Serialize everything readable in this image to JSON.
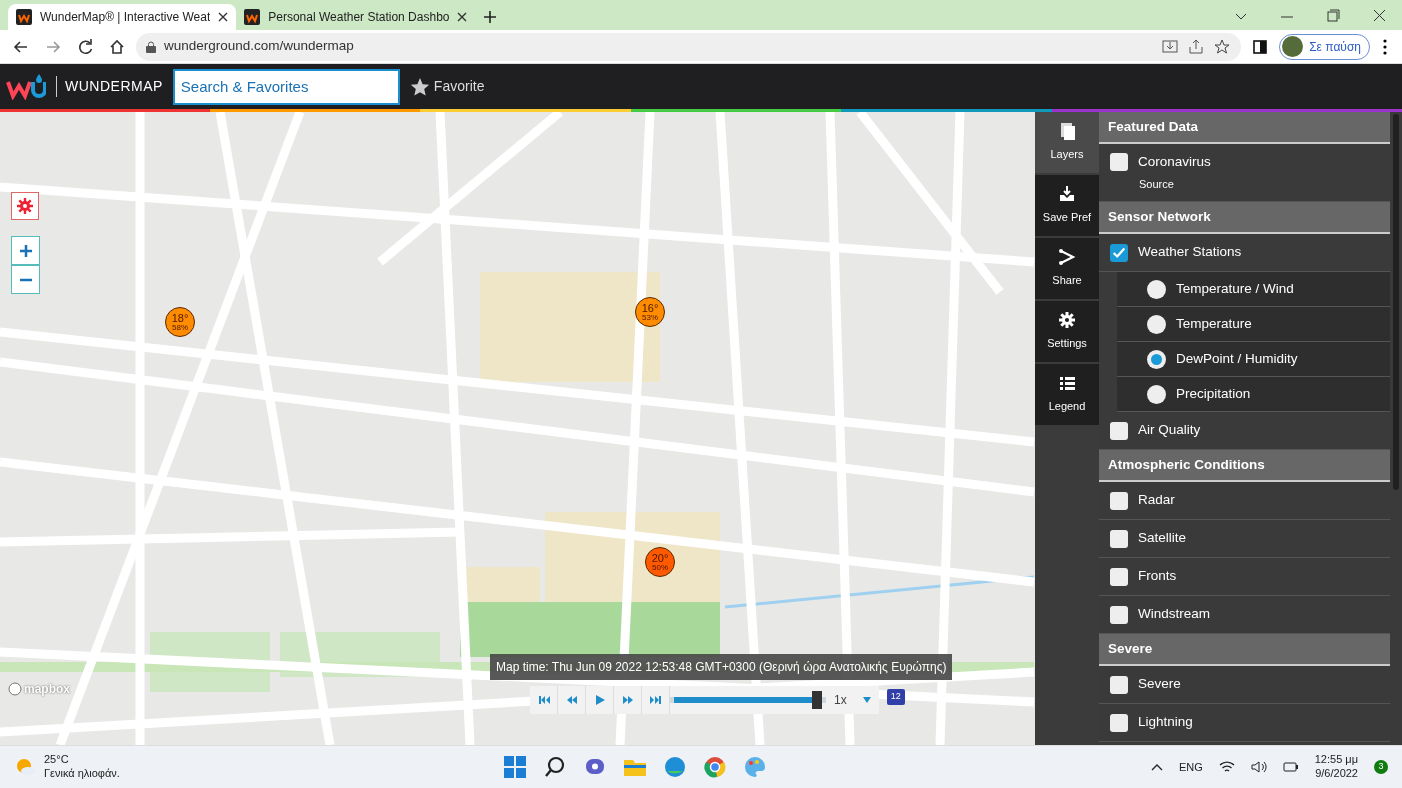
{
  "browser": {
    "tabs": [
      {
        "title": "WunderMap® | Interactive Weat",
        "selected": true
      },
      {
        "title": "Personal Weather Station Dashbo",
        "selected": false
      }
    ],
    "address": "wunderground.com/wundermap",
    "profile": "Σε παύση"
  },
  "header": {
    "logo": "WUNDERMAP",
    "search": {
      "placeholder": "Search & Favorites"
    },
    "favorite": "Favorite"
  },
  "map": {
    "stations": [
      {
        "temp": "18°",
        "humidity": "58%",
        "color": "#ff8c00"
      },
      {
        "temp": "16°",
        "humidity": "53%",
        "color": "#ff8c00"
      },
      {
        "temp": "20°",
        "humidity": "50%",
        "color": "#ff5a00"
      }
    ],
    "attribution": "mapbox",
    "map_time": "Map time: Thu Jun 09 2022 12:53:48 GMT+0300 (Θερινή ώρα Ανατολικής Ευρώπης)",
    "playback": {
      "level": 1,
      "speed": "1x",
      "frame_badge": "12"
    }
  },
  "tools": [
    {
      "label": "Layers",
      "selected": true,
      "kind": "layers"
    },
    {
      "label": "Save Pref",
      "selected": false,
      "kind": "save"
    },
    {
      "label": "Share",
      "selected": false,
      "kind": "share"
    },
    {
      "label": "Settings",
      "selected": false,
      "kind": "settings"
    },
    {
      "label": "Legend",
      "selected": false,
      "kind": "legend"
    }
  ],
  "layers": [
    {
      "title": "Featured Data",
      "items": [
        {
          "label": "Coronavirus",
          "checked": false,
          "note": "Source"
        }
      ]
    },
    {
      "title": "Sensor Network",
      "items": [
        {
          "label": "Weather Stations",
          "checked": true,
          "options": [
            {
              "label": "Temperature / Wind",
              "selected": false
            },
            {
              "label": "Temperature",
              "selected": false
            },
            {
              "label": "DewPoint / Humidity",
              "selected": true
            },
            {
              "label": "Precipitation",
              "selected": false
            }
          ]
        },
        {
          "label": "Air Quality",
          "checked": false
        }
      ]
    },
    {
      "title": "Atmospheric Conditions",
      "items": [
        {
          "label": "Radar",
          "checked": false
        },
        {
          "label": "Satellite",
          "checked": false
        },
        {
          "label": "Fronts",
          "checked": false
        },
        {
          "label": "Windstream",
          "checked": false
        }
      ]
    },
    {
      "title": "Severe",
      "items": [
        {
          "label": "Severe",
          "checked": false
        },
        {
          "label": "Lightning",
          "checked": false
        }
      ]
    }
  ],
  "taskbar": {
    "weather_temp": "25°C",
    "weather_text": "Γενικά ηλιοφάν.",
    "language": "ENG",
    "time": "12:55 μμ",
    "date": "9/6/2022",
    "notifications": "3"
  }
}
